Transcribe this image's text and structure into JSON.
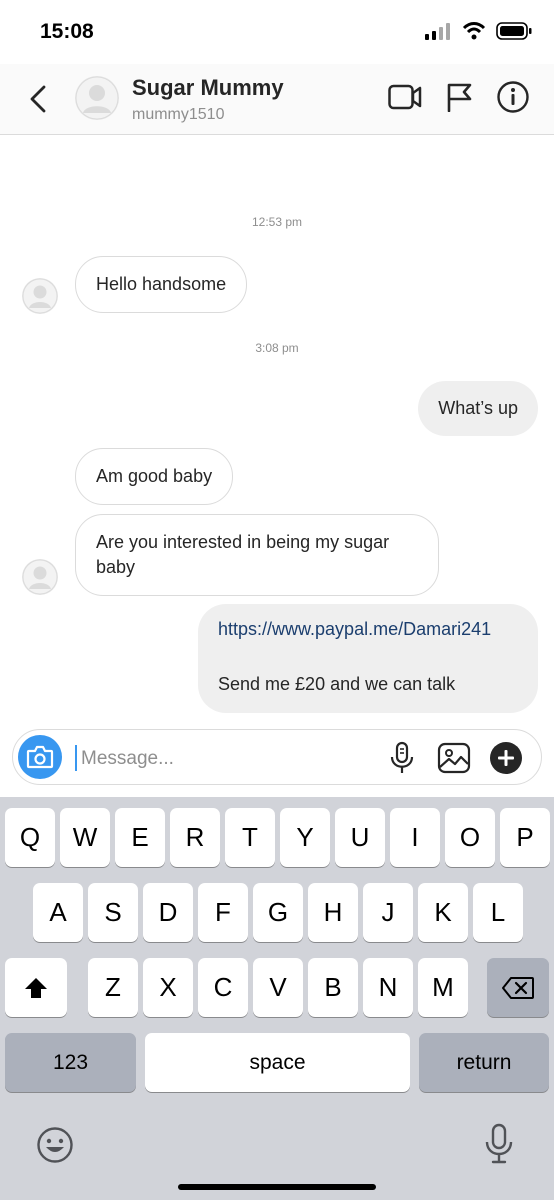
{
  "status": {
    "time": "15:08"
  },
  "header": {
    "contact_name": "Sugar Mummy",
    "username": "mummy1510"
  },
  "thread": {
    "timestamps": [
      "12:53 pm",
      "3:08 pm"
    ],
    "messages": [
      {
        "sender": "incoming",
        "text": "Hello handsome"
      },
      {
        "sender": "outgoing",
        "text": "What’s up"
      },
      {
        "sender": "incoming",
        "text": "Am good baby"
      },
      {
        "sender": "incoming",
        "text": "Are you interested in being my sugar baby"
      },
      {
        "sender": "outgoing",
        "link": "https://www.paypal.me/Damari241",
        "text": "Send me £20 and we can talk"
      }
    ]
  },
  "composer": {
    "placeholder": "Message...",
    "value": ""
  },
  "keyboard": {
    "row1": [
      "Q",
      "W",
      "E",
      "R",
      "T",
      "Y",
      "U",
      "I",
      "O",
      "P"
    ],
    "row2": [
      "A",
      "S",
      "D",
      "F",
      "G",
      "H",
      "J",
      "K",
      "L"
    ],
    "row3": [
      "Z",
      "X",
      "C",
      "V",
      "B",
      "N",
      "M"
    ],
    "numbers_label": "123",
    "space_label": "space",
    "return_label": "return"
  },
  "colors": {
    "accent": "#3897f0",
    "link": "#1b3e6e",
    "bubble_outgoing": "#efefef",
    "keyboard_bg": "#d1d3d9"
  },
  "icons": {
    "header": [
      "back-chevron-icon",
      "video-call-icon",
      "flag-icon",
      "info-icon"
    ],
    "composer": [
      "camera-icon",
      "microphone-icon",
      "gallery-icon",
      "plus-icon"
    ],
    "keyboard": [
      "shift-icon",
      "delete-icon",
      "emoji-icon",
      "dictation-icon"
    ]
  }
}
